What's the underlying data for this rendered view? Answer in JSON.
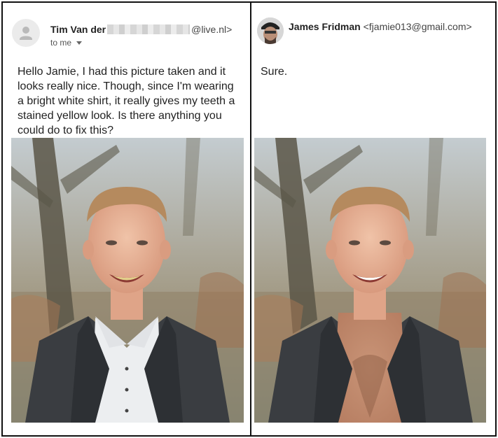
{
  "left": {
    "sender_name": "Tim Van der",
    "sender_email_suffix": "@live.nl>",
    "recipient_label": "to me",
    "message": "Hello Jamie, I had this picture taken and it looks really nice. Though, since I'm wearing a bright white shirt, it really gives my teeth a stained yellow look. Is there anything you could do to fix this?",
    "photo_icon": "portrait-with-white-shirt"
  },
  "right": {
    "sender_name": "James Fridman",
    "sender_email": "<fjamie013@gmail.com>",
    "message": "Sure.",
    "photo_icon": "portrait-shirtless-edit"
  },
  "colors": {
    "text": "#222222",
    "border": "#111111",
    "avatar_bg": "#ebebeb"
  }
}
